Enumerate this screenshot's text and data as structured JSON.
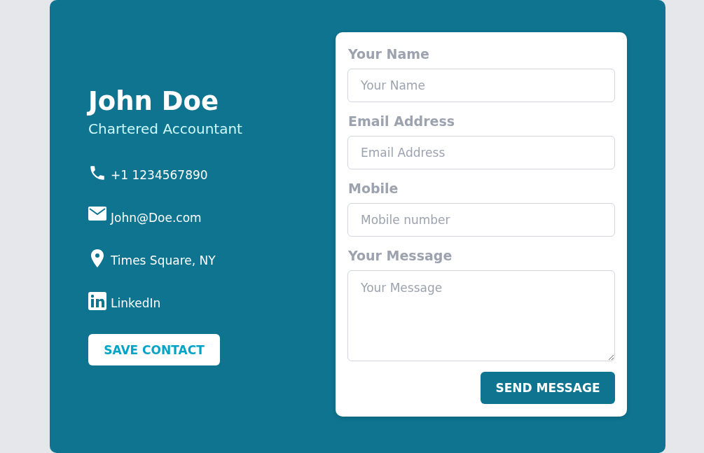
{
  "profile": {
    "name": "John Doe",
    "title": "Chartered Accountant"
  },
  "contacts": [
    {
      "kind": "phone",
      "text": "+1 1234567890"
    },
    {
      "kind": "email",
      "text": "John@Doe.com"
    },
    {
      "kind": "location",
      "text": "Times Square, NY"
    },
    {
      "kind": "linkedin",
      "text": "LinkedIn"
    }
  ],
  "save_button": "SAVE CONTACT",
  "form": {
    "fields": [
      {
        "kind": "input",
        "label": "Your Name",
        "placeholder": "Your Name"
      },
      {
        "kind": "input",
        "label": "Email Address",
        "placeholder": "Email Address"
      },
      {
        "kind": "input",
        "label": "Mobile",
        "placeholder": "Mobile number"
      },
      {
        "kind": "textarea",
        "label": "Your Message",
        "placeholder": "Your Message"
      }
    ],
    "submit": "SEND MESSAGE"
  }
}
